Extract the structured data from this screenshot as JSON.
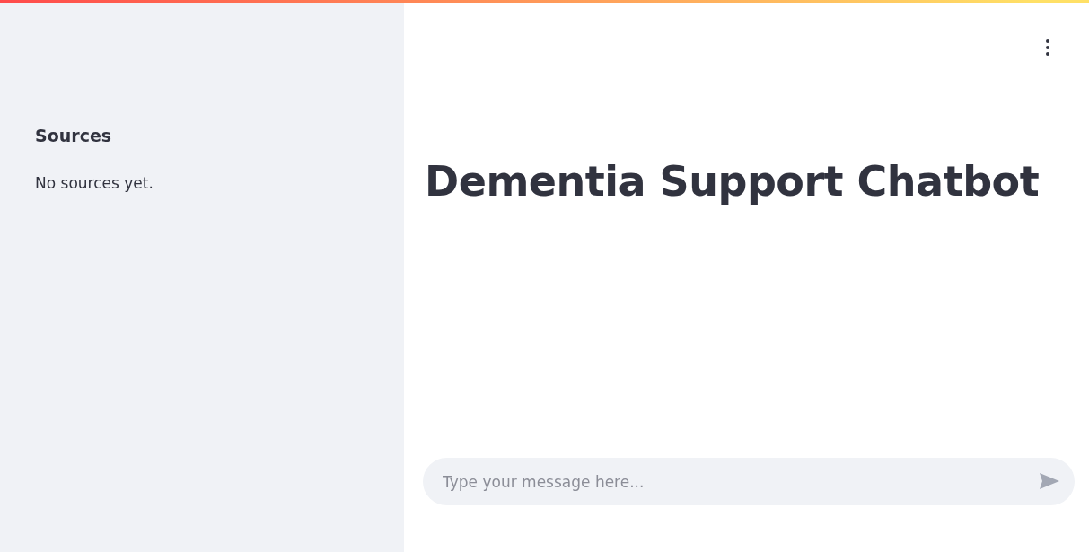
{
  "sidebar": {
    "heading": "Sources",
    "message": "No sources yet."
  },
  "main": {
    "title": "Dementia Support Chatbot"
  },
  "chat_input": {
    "placeholder": "Type your message here..."
  }
}
